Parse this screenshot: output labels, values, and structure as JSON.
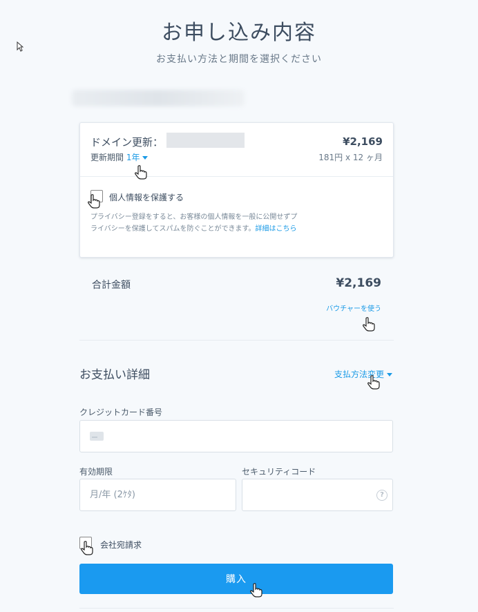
{
  "header": {
    "title": "お申し込み内容",
    "subtitle": "お支払い方法と期間を選択ください"
  },
  "renewal": {
    "label": "ドメイン更新：",
    "price": "¥2,169",
    "period_label": "更新期間",
    "period_value": "1年",
    "monthly": "181円 x 12 ヶ月"
  },
  "privacy": {
    "label": "個人情報を保護する",
    "description": "プライバシー登録をすると、お客様の個人情報を一般に公開せずプライバシーを保護してスパムを防ぐことができます。",
    "link": "詳細はこちら"
  },
  "total": {
    "label": "合計金額",
    "price": "¥2,169",
    "voucher": "バウチャーを使う"
  },
  "payment": {
    "title": "お支払い詳細",
    "change_method": "支払方法変更",
    "card_number_label": "クレジットカード番号",
    "card_number_value": "",
    "expiry_label": "有効期限",
    "expiry_placeholder": "月/年 (2ｹﾀ)",
    "security_label": "セキュリティコード",
    "security_value": "",
    "help_glyph": "?",
    "company_label": "会社宛請求",
    "buy_label": "購入"
  },
  "icons": {
    "caret": "chevron-down-icon",
    "card": "credit-card-icon",
    "help": "help-icon",
    "cursor": "hand-pointer-icon"
  },
  "colors": {
    "accent": "#1a9ae6",
    "button": "#1a9af0",
    "background": "#f6f9fc"
  }
}
